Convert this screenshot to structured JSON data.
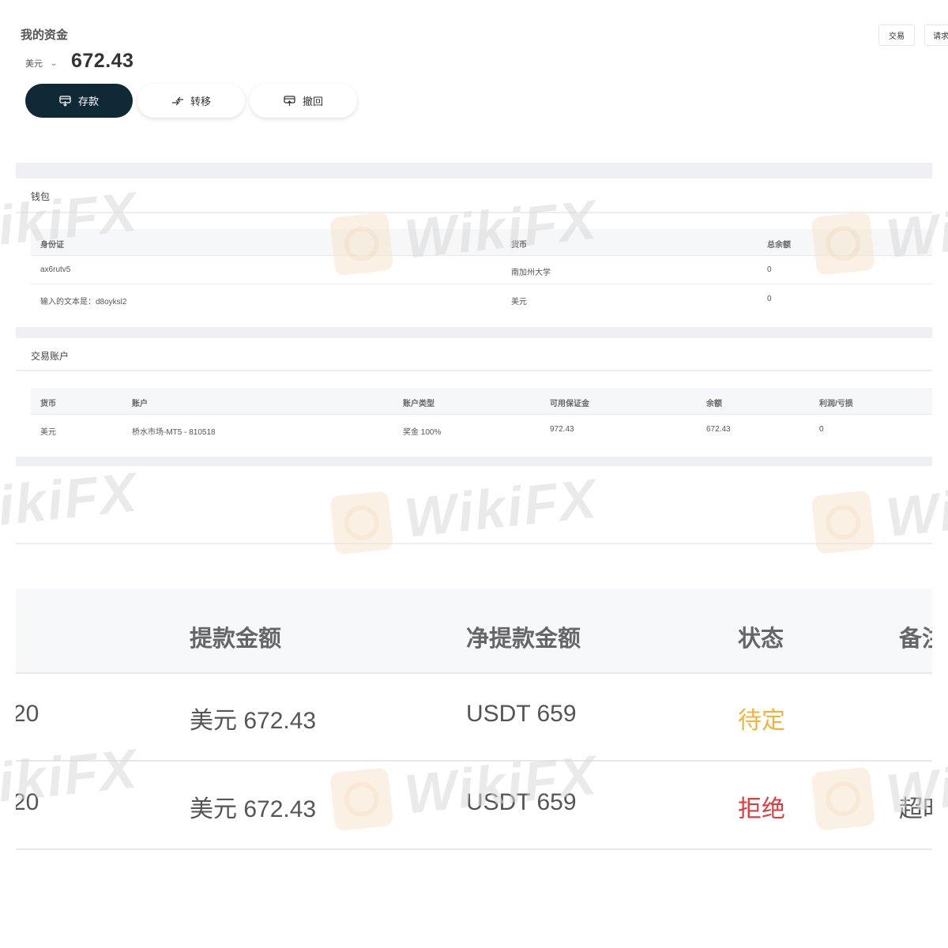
{
  "header": {
    "title": "我的资金",
    "currency": "美元",
    "balance": "672.43",
    "trade_button": "交易",
    "request_button": "请求"
  },
  "actions": {
    "deposit": "存款",
    "transfer": "转移",
    "withdraw": "撤回"
  },
  "wallet": {
    "title": "钱包",
    "columns": [
      "身份证",
      "货币",
      "总余额"
    ],
    "rows": [
      [
        "ax6rutv5",
        "南加州大学",
        "0"
      ],
      [
        "输入的文本是：d8oyksl2",
        "美元",
        "0"
      ]
    ]
  },
  "trading_accounts": {
    "title": "交易账户",
    "columns": [
      "货币",
      "账户",
      "账户类型",
      "可用保证金",
      "余额",
      "利润/亏损"
    ],
    "rows": [
      [
        "美元",
        "桥水市场-MT5 - 810518",
        "奖金 100%",
        "972.43",
        "672.43",
        "0"
      ]
    ]
  },
  "withdrawals": {
    "columns": [
      "提款金额",
      "净提款金额",
      "状态",
      "备注"
    ],
    "rows": [
      {
        "date_fragment": "20",
        "amount": "美元 672.43",
        "net": "USDT 659",
        "status": "待定",
        "note": ""
      },
      {
        "date_fragment": "20",
        "amount": "美元 672.43",
        "net": "USDT 659",
        "status": "拒绝",
        "note": "超时"
      }
    ]
  },
  "watermark": "WikiFX"
}
